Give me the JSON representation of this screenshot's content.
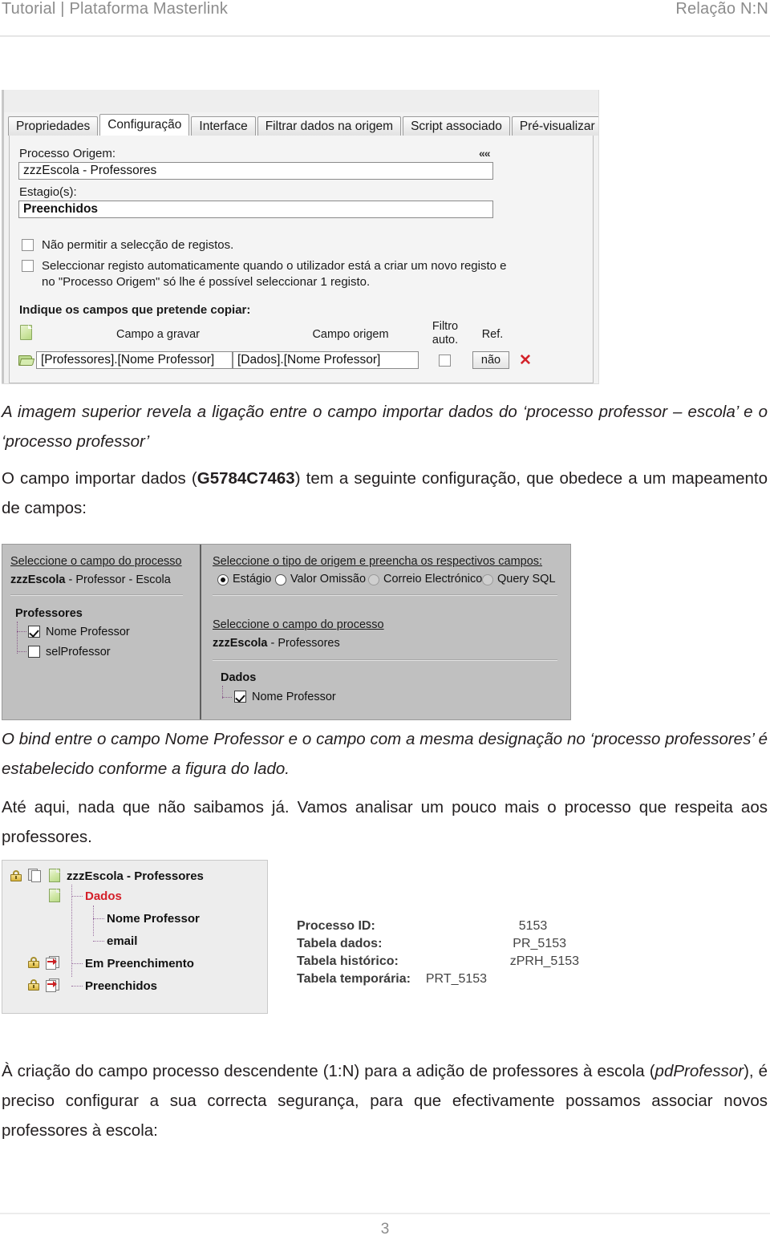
{
  "header": {
    "left_title": "Tutorial | Plataforma Masterlink",
    "right_title": "Relação N:N"
  },
  "screenshot_config_dialog": {
    "tabs": [
      {
        "label": "Propriedades",
        "active": false
      },
      {
        "label": "Configuração",
        "active": true
      },
      {
        "label": "Interface",
        "active": false
      },
      {
        "label": "Filtrar dados na origem",
        "active": false
      },
      {
        "label": "Script associado",
        "active": false
      },
      {
        "label": "Pré-visualizar",
        "active": false
      }
    ],
    "processo_origem_label": "Processo Origem:",
    "processo_origem_value": "zzzEscola - Professores",
    "collapse_glyph": "««",
    "estagios_label": "Estagio(s):",
    "estagios_value": "Preenchidos",
    "checkbox_1_label": "Não permitir a selecção de registos.",
    "checkbox_2_label_line1": "Seleccionar registo automaticamente quando o utilizador está a criar um novo registo e",
    "checkbox_2_label_line2": "no \"Processo Origem\" só lhe é possível seleccionar 1 registo.",
    "campos_instruction": "Indique os campos que pretende copiar:",
    "column_headers": {
      "campo_a_gravar": "Campo a gravar",
      "campo_origem": "Campo origem",
      "filtro_auto_line1": "Filtro",
      "filtro_auto_line2": "auto.",
      "ref": "Ref."
    },
    "mapping_row": {
      "campo_a_gravar": "[Professores].[Nome Professor]",
      "campo_origem": "[Dados].[Nome Professor]",
      "filtro_auto_checked": false,
      "ref_button": "não",
      "delete_glyph": "✕"
    }
  },
  "paragraph_1": {
    "text": "A imagem superior revela a ligação entre o campo importar dados do ‘processo professor – escola’ e o ‘processo professor’"
  },
  "paragraph_2": {
    "prefix": "O campo importar dados (",
    "code": "G5784C7463",
    "suffix": ") tem a seguinte configuração, que obedece a um mapeamento de campos:"
  },
  "screenshot_field_mapping": {
    "left_panel": {
      "header": "Seleccione o campo do processo",
      "process_value_bold": "zzzEscola",
      "process_value_rest": " - Professor - Escola",
      "group": "Professores",
      "fields": [
        {
          "label": "Nome Professor",
          "checked": true
        },
        {
          "label": "selProfessor",
          "checked": false
        }
      ]
    },
    "right_panel": {
      "header": "Seleccione o tipo de origem e preencha os respectivos campos:",
      "radios": [
        {
          "label": "Estágio",
          "selected": true,
          "disabled": false
        },
        {
          "label": "Valor Omissão",
          "selected": false,
          "disabled": false
        },
        {
          "label": "Correio Electrónico",
          "selected": false,
          "disabled": true
        },
        {
          "label": "Query SQL",
          "selected": false,
          "disabled": true
        }
      ],
      "sub_header": "Seleccione o campo do processo",
      "process_value_bold": "zzzEscola",
      "process_value_rest": " - Professores",
      "group": "Dados",
      "fields": [
        {
          "label": "Nome Professor",
          "checked": true
        }
      ]
    }
  },
  "paragraph_3": {
    "text": "O bind entre o campo Nome Professor e o campo com a mesma designação no ‘processo professores’ é estabelecido conforme a figura do lado."
  },
  "paragraph_4": {
    "text": "Até aqui, nada que não saibamos já. Vamos analisar um pouco mais o processo que respeita aos professores."
  },
  "screenshot_process_tree": {
    "root": "zzzEscola - Professores",
    "nodes": [
      {
        "label": "Dados",
        "highlight": true
      },
      {
        "label": "Nome Professor",
        "highlight": false
      },
      {
        "label": "email",
        "highlight": false
      },
      {
        "label": "Em Preenchimento",
        "highlight": false
      },
      {
        "label": "Preenchidos",
        "highlight": false
      }
    ],
    "info": [
      {
        "key": "Processo ID:",
        "value": "5153"
      },
      {
        "key": "Tabela dados:",
        "value": "PR_5153"
      },
      {
        "key": "Tabela histórico:",
        "value": "zPRH_5153"
      },
      {
        "key": "Tabela temporária:",
        "value": "PRT_5153"
      }
    ]
  },
  "paragraph_5": {
    "prefix": "À criação do campo processo descendente (1:N) para a adição de professores à escola (",
    "code": "pdProfessor",
    "suffix": "), é preciso configurar a sua correcta segurança, para que efectivamente possamos associar novos professores à escola:"
  },
  "footer": {
    "page_number": "3"
  }
}
